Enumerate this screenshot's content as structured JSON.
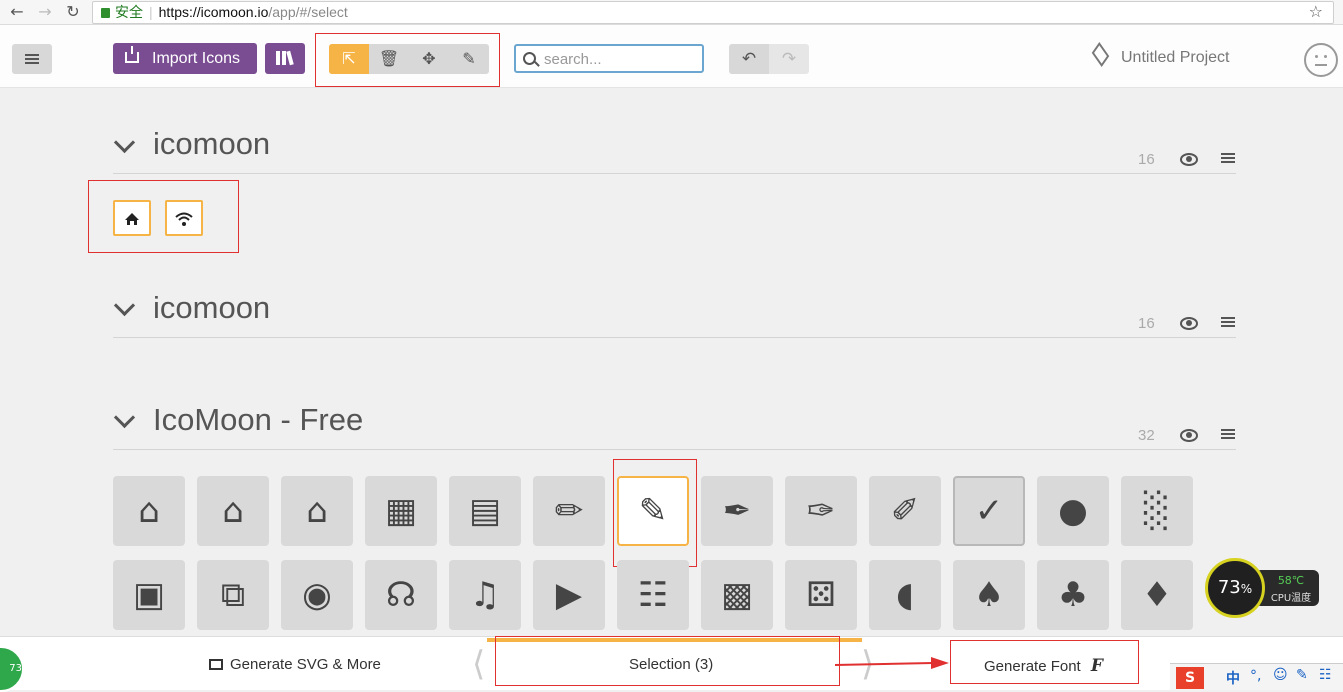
{
  "browser": {
    "security_label": "安全",
    "url_host": "https://icomoon.io",
    "url_path": "/app/#/select",
    "back_icon": "arrow-left-icon",
    "forward_icon": "arrow-right-icon",
    "reload_icon": "reload-icon",
    "star_icon": "star-icon"
  },
  "toolbar": {
    "import_label": "Import Icons",
    "search_placeholder": "search...",
    "project_label": "Untitled Project",
    "tools": [
      "select",
      "delete",
      "move",
      "edit"
    ]
  },
  "sets": [
    {
      "title": "icomoon",
      "count": "16"
    },
    {
      "title": "icomoon",
      "count": "16"
    },
    {
      "title": "IcoMoon - Free",
      "count": "32"
    }
  ],
  "selected_icons": [
    "home-icon",
    "wifi-icon"
  ],
  "free_row1": [
    "home",
    "home2",
    "home3",
    "office",
    "newspaper",
    "pencil",
    "pencil2",
    "quill",
    "pen",
    "blog",
    "eyedropper",
    "droplet",
    "paint-format"
  ],
  "free_row2": [
    "image",
    "images",
    "camera",
    "headphones",
    "music",
    "play",
    "film",
    "video-camera",
    "dice",
    "pacman",
    "spades",
    "clubs",
    "diamonds"
  ],
  "bottom": {
    "svg_label": "Generate SVG & More",
    "selection_label": "Selection (3)",
    "font_label": "Generate Font",
    "font_glyph": "F"
  },
  "cpu": {
    "percent": "73",
    "unit": "%",
    "temp": "58℃",
    "label": "CPU温度"
  },
  "tray_badge": "73",
  "colors": {
    "accent": "#f7b446",
    "brand": "#7a4d93",
    "annotation": "#e03030",
    "tile": "#d9d9d9"
  }
}
